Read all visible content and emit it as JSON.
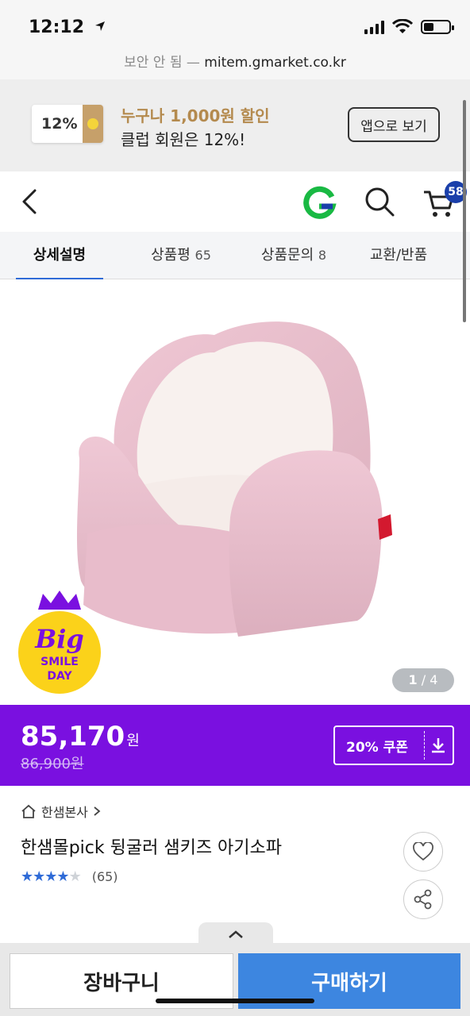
{
  "status_bar": {
    "time": "12:12",
    "url_prefix": "보안 안 됨 — ",
    "url": "mitem.gmarket.co.kr"
  },
  "promo": {
    "badge": "12%",
    "title": "누구나 1,000원 할인",
    "subtitle": "클럽 회원은 12%!",
    "app_button": "앱으로 보기"
  },
  "header": {
    "cart_count": "58",
    "logo": "G"
  },
  "tabs": [
    {
      "label": "상세설명",
      "count": ""
    },
    {
      "label": "상품평",
      "count": "65"
    },
    {
      "label": "상품문의",
      "count": "8"
    },
    {
      "label": "교환/반품",
      "count": ""
    }
  ],
  "gallery": {
    "current": "1",
    "separator": " / ",
    "total": "4",
    "badge_text": [
      "Big",
      "SMILE",
      "DAY"
    ]
  },
  "price": {
    "sale": "85,170",
    "unit": "원",
    "original": "86,900원",
    "coupon_label": "20% 쿠폰"
  },
  "product": {
    "seller": "한샘본사",
    "title": "한샘몰pick 뒹굴러 샘키즈 아기소파",
    "rating": 4,
    "review_count": "(65)"
  },
  "bottom": {
    "cart_button": "장바구니",
    "buy_button": "구매하기"
  },
  "colors": {
    "accent_purple": "#7a10e0",
    "buy_blue": "#3d86e0",
    "tab_underline": "#2f6bd7",
    "cart_badge": "#1a3faa"
  }
}
